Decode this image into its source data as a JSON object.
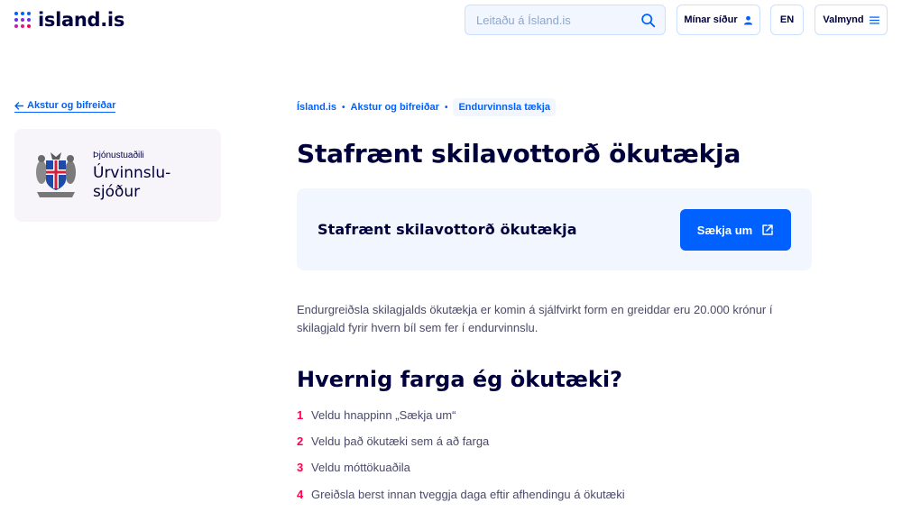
{
  "header": {
    "logo_text": "island.is",
    "logo_dot_colors": [
      "#0061ff",
      "#0061ff",
      "#0061ff",
      "#6a2ee8",
      "#8b2bd4",
      "#6a2ee8",
      "#c21ea8",
      "#e01a7a",
      "#ff0050"
    ],
    "search_placeholder": "Leitaðu á Ísland.is",
    "my_pages_label": "Mínar síður",
    "language_label": "EN",
    "menu_label": "Valmynd"
  },
  "sidebar": {
    "back_link_label": "Akstur og bifreiðar",
    "provider_label": "Þjónustuaðili",
    "provider_name": "Úrvinnslu-sjóður"
  },
  "breadcrumb": {
    "items": [
      "Ísland.is",
      "Akstur og bifreiðar"
    ],
    "current": "Endurvinnsla tækja"
  },
  "main": {
    "title": "Stafrænt skilavottorð ökutækja",
    "apply_box_title": "Stafrænt skilavottorð ökutækja",
    "apply_button_label": "Sækja um",
    "intro": "Endurgreiðsla skilagjalds ökutækja er komin á sjálfvirkt form en greiddar eru 20.000 krónur í skilagjald fyrir hvern bíl sem fer í endurvinnslu.",
    "section_title": "Hvernig farga ég ökutæki?",
    "steps": [
      {
        "num": "1",
        "text": "Veldu hnappinn „Sækja um“"
      },
      {
        "num": "2",
        "text": "Veldu það ökutæki sem á að farga"
      },
      {
        "num": "3",
        "text": "Veldu móttökuaðila"
      },
      {
        "num": "4",
        "text": "Greiðsla berst innan tveggja daga eftir afhendingu á ökutæki"
      }
    ]
  },
  "colors": {
    "primary": "#0061ff",
    "dark": "#00003c",
    "accent_red": "#ff0050",
    "light_blue": "#f2f7ff"
  }
}
